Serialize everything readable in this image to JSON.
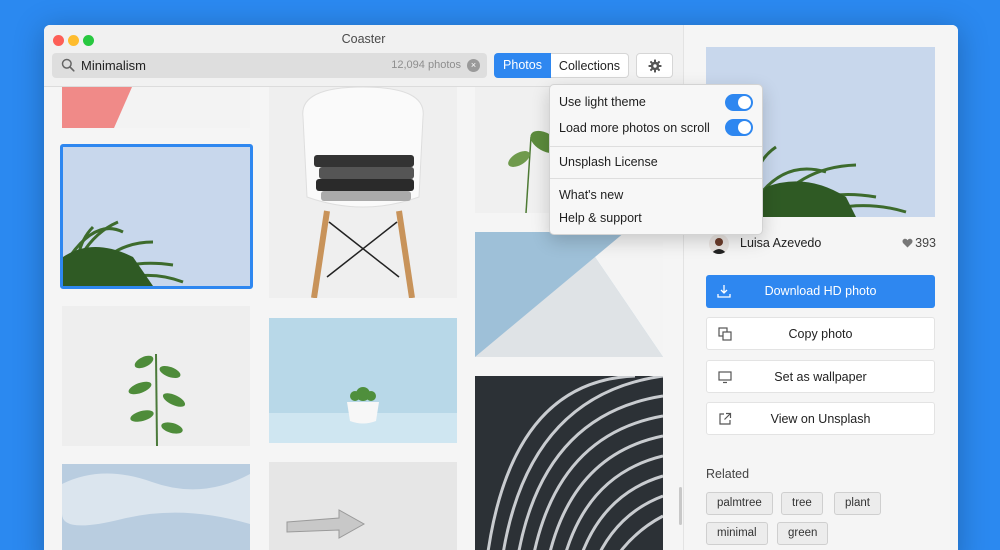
{
  "window": {
    "title": "Coaster"
  },
  "search": {
    "query": "Minimalism",
    "count": "12,094 photos",
    "clear_glyph": "×"
  },
  "tabs": {
    "photos": "Photos",
    "collections": "Collections",
    "active": "Photos"
  },
  "settings_menu": {
    "items": [
      {
        "label": "Use light theme",
        "toggle": true
      },
      {
        "label": "Load more photos on scroll",
        "toggle": true
      },
      {
        "label": "Unsplash License"
      },
      {
        "label": "What's new"
      },
      {
        "label": "Help & support"
      }
    ]
  },
  "photo": {
    "author": "Luisa Azevedo",
    "likes": "393"
  },
  "actions": {
    "download": "Download HD photo",
    "copy": "Copy photo",
    "wallpaper": "Set as wallpaper",
    "view": "View on Unsplash"
  },
  "related": {
    "title": "Related",
    "tags": [
      "palmtree",
      "tree",
      "plant",
      "minimal",
      "green"
    ]
  },
  "colors": {
    "accent": "#2e87f0",
    "desktop": "#2b89f0"
  },
  "icons": [
    "search-icon",
    "clear-icon",
    "gear-icon",
    "heart-icon",
    "download-icon",
    "copy-icon",
    "monitor-icon",
    "external-link-icon"
  ]
}
